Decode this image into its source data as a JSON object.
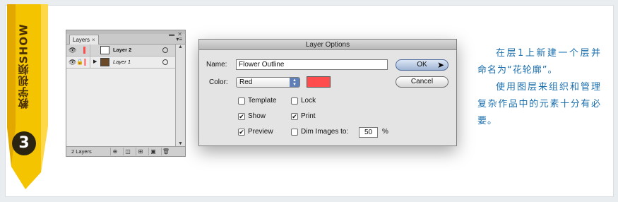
{
  "tag": {
    "label": "教学视频SHOW",
    "step": "3",
    "color": "#f5c400"
  },
  "layers_panel": {
    "tab_label": "Layers",
    "tab_close": "×",
    "layers": [
      {
        "name": "Layer 2",
        "color": "#ff4d4d",
        "selected": true
      },
      {
        "name": "Layer 1",
        "color": "#ff8c8c",
        "selected": false
      }
    ],
    "count_label": "2 Layers"
  },
  "dialog": {
    "title": "Layer Options",
    "name_label": "Name:",
    "name_value": "Flower Outline",
    "color_label": "Color:",
    "color_value": "Red",
    "swatch_color": "#ff4d4d",
    "options": {
      "template": {
        "label": "Template",
        "checked": false
      },
      "lock": {
        "label": "Lock",
        "checked": false
      },
      "show": {
        "label": "Show",
        "checked": true
      },
      "print": {
        "label": "Print",
        "checked": true
      },
      "preview": {
        "label": "Preview",
        "checked": true
      },
      "dim": {
        "label": "Dim Images to:",
        "checked": false
      }
    },
    "dim_value": "50",
    "dim_unit": "%",
    "ok_label": "OK",
    "cancel_label": "Cancel"
  },
  "description": {
    "para1": "在层1上新建一个层并命名为“花轮廓”。",
    "para2": "使用图层来组织和管理复杂作品中的元素十分有必要。",
    "color": "#1b6fae"
  }
}
